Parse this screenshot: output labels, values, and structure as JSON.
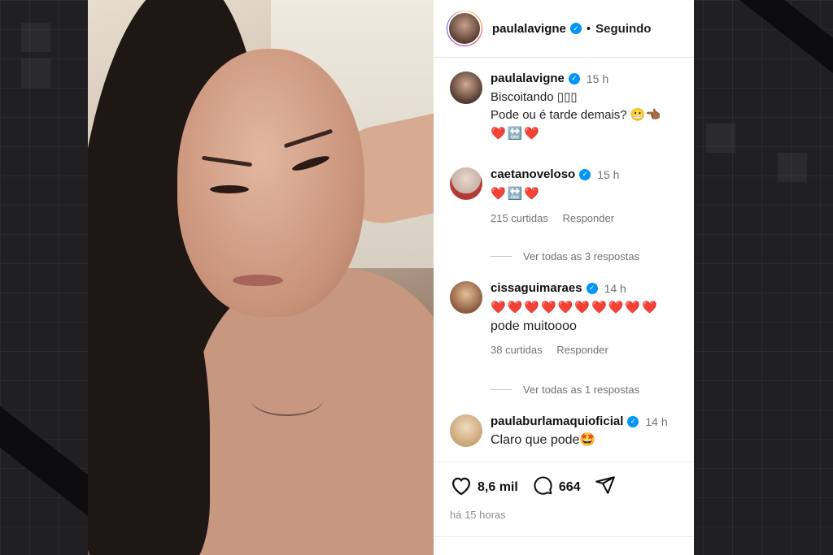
{
  "post": {
    "author": "paulalavigne",
    "follow_status": "Seguindo",
    "separator": "•",
    "caption_time": "15 h",
    "caption_line1": "Biscoitando ▯▯▯",
    "caption_line2": "Pode ou é tarde demais? 😬👈🏾",
    "caption_emojis": "❤️🔛❤️",
    "likes": "8,6 mil",
    "comments_count": "664",
    "time_ago": "há 15 horas"
  },
  "comments": [
    {
      "user": "caetanoveloso",
      "time": "15 h",
      "text": "❤️🔛❤️",
      "likes": "215 curtidas",
      "reply": "Responder",
      "view_replies": "Ver todas as 3 respostas"
    },
    {
      "user": "cissaguimaraes",
      "time": "14 h",
      "text": "❤️❤️❤️❤️❤️❤️❤️❤️❤️❤️",
      "text2": "pode muitoooo",
      "likes": "38 curtidas",
      "reply": "Responder",
      "view_replies": "Ver todas as 1 respostas"
    },
    {
      "user": "paulaburlamaquioficial",
      "time": "14 h",
      "text": "Claro que pode🤩"
    }
  ],
  "icons": {
    "verified": "✓",
    "heart": "heart-icon",
    "comment": "comment-icon",
    "share": "send-icon"
  },
  "colors": {
    "verified_blue": "#0095f6",
    "muted_text": "#737373"
  }
}
